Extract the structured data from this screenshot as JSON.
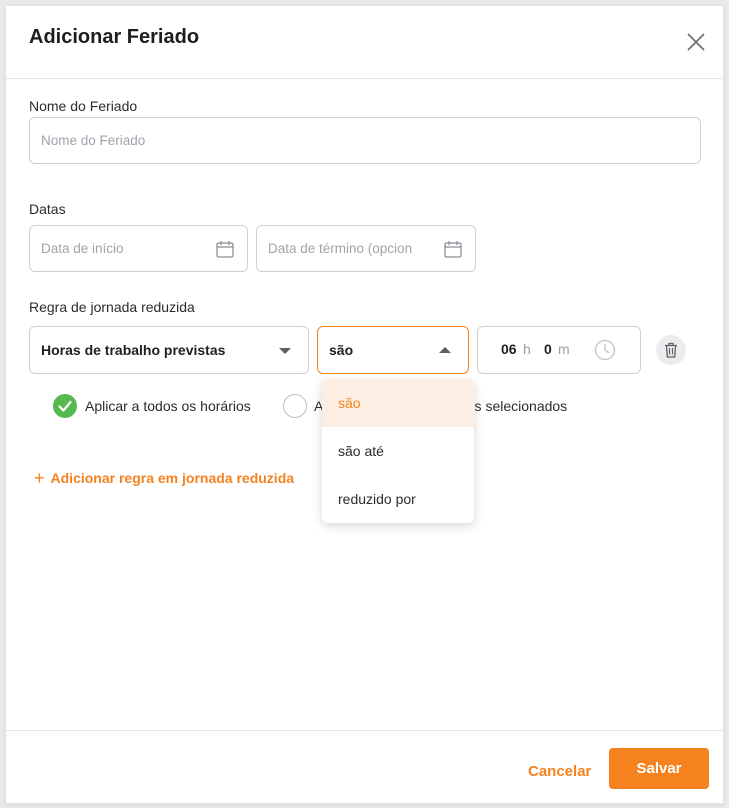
{
  "modal": {
    "title": "Adicionar Feriado",
    "close_icon": "close-icon"
  },
  "holiday_name": {
    "label": "Nome do Feriado",
    "placeholder": "Nome do Feriado",
    "value": ""
  },
  "dates": {
    "label": "Datas",
    "start_placeholder": "Data de início",
    "end_placeholder": "Data de término (opcion",
    "calendar_icon": "calendar-icon"
  },
  "reduced_rule": {
    "label": "Regra de jornada reduzida",
    "type_select": {
      "value": "Horas de trabalho previstas",
      "icon": "chevron-down-icon"
    },
    "operator_select": {
      "value": "são",
      "icon": "chevron-up-icon"
    },
    "time": {
      "hours": "06",
      "hours_unit": "h",
      "minutes": "0",
      "minutes_unit": "m",
      "icon": "clock-icon"
    },
    "delete_icon": "trash-icon"
  },
  "apply_options": [
    {
      "label": "Aplicar a todos os horários",
      "checked": true
    },
    {
      "label": "A",
      "suffix": "rios selecionados",
      "checked": false
    }
  ],
  "add_rule_label": "Adicionar regra em jornada reduzida",
  "dropdown_options": [
    {
      "label": "são",
      "selected": true
    },
    {
      "label": "são até",
      "selected": false
    },
    {
      "label": "reduzido por",
      "selected": false
    }
  ],
  "footer": {
    "cancel_label": "Cancelar",
    "save_label": "Salvar"
  },
  "colors": {
    "accent": "#f5821f",
    "success": "#55b94f",
    "dropdown_selected_bg": "#fdeee3"
  }
}
